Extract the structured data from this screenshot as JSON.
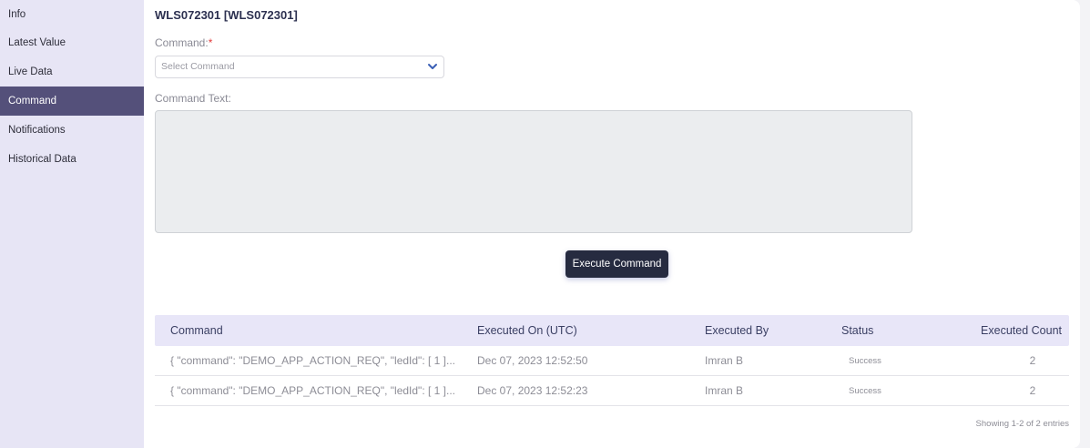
{
  "sidebar": {
    "items": [
      {
        "label": "Info",
        "active": false
      },
      {
        "label": "Latest Value",
        "active": false
      },
      {
        "label": "Live Data",
        "active": false
      },
      {
        "label": "Command",
        "active": true
      },
      {
        "label": "Notifications",
        "active": false
      },
      {
        "label": "Historical Data",
        "active": false
      }
    ]
  },
  "device": {
    "title": "WLS072301 [WLS072301]"
  },
  "form": {
    "command_label": "Command:",
    "required_marker": "*",
    "select_placeholder": "Select Command",
    "command_text_label": "Command Text:",
    "command_text_value": "",
    "execute_label": "Execute Command"
  },
  "table": {
    "headers": {
      "command": "Command",
      "executed_on": "Executed On (UTC)",
      "executed_by": "Executed By",
      "status": "Status",
      "executed_count": "Executed Count"
    },
    "rows": [
      {
        "command": "{ \"command\": \"DEMO_APP_ACTION_REQ\", \"ledId\": [ 1 ]...",
        "executed_on": "Dec 07, 2023 12:52:50",
        "executed_by": "Imran B",
        "status": "Success",
        "executed_count": "2"
      },
      {
        "command": "{ \"command\": \"DEMO_APP_ACTION_REQ\", \"ledId\": [ 1 ]...",
        "executed_on": "Dec 07, 2023 12:52:23",
        "executed_by": "Imran B",
        "status": "Success",
        "executed_count": "2"
      }
    ],
    "footer": "Showing 1-2 of 2 entries"
  },
  "colors": {
    "sidebar_bg": "#e7e5f5",
    "sidebar_active": "#54507a",
    "button_bg": "#262b40",
    "table_header_bg": "#e8e6f8"
  },
  "icons": {
    "select_chevron": "chevron-down-icon"
  }
}
